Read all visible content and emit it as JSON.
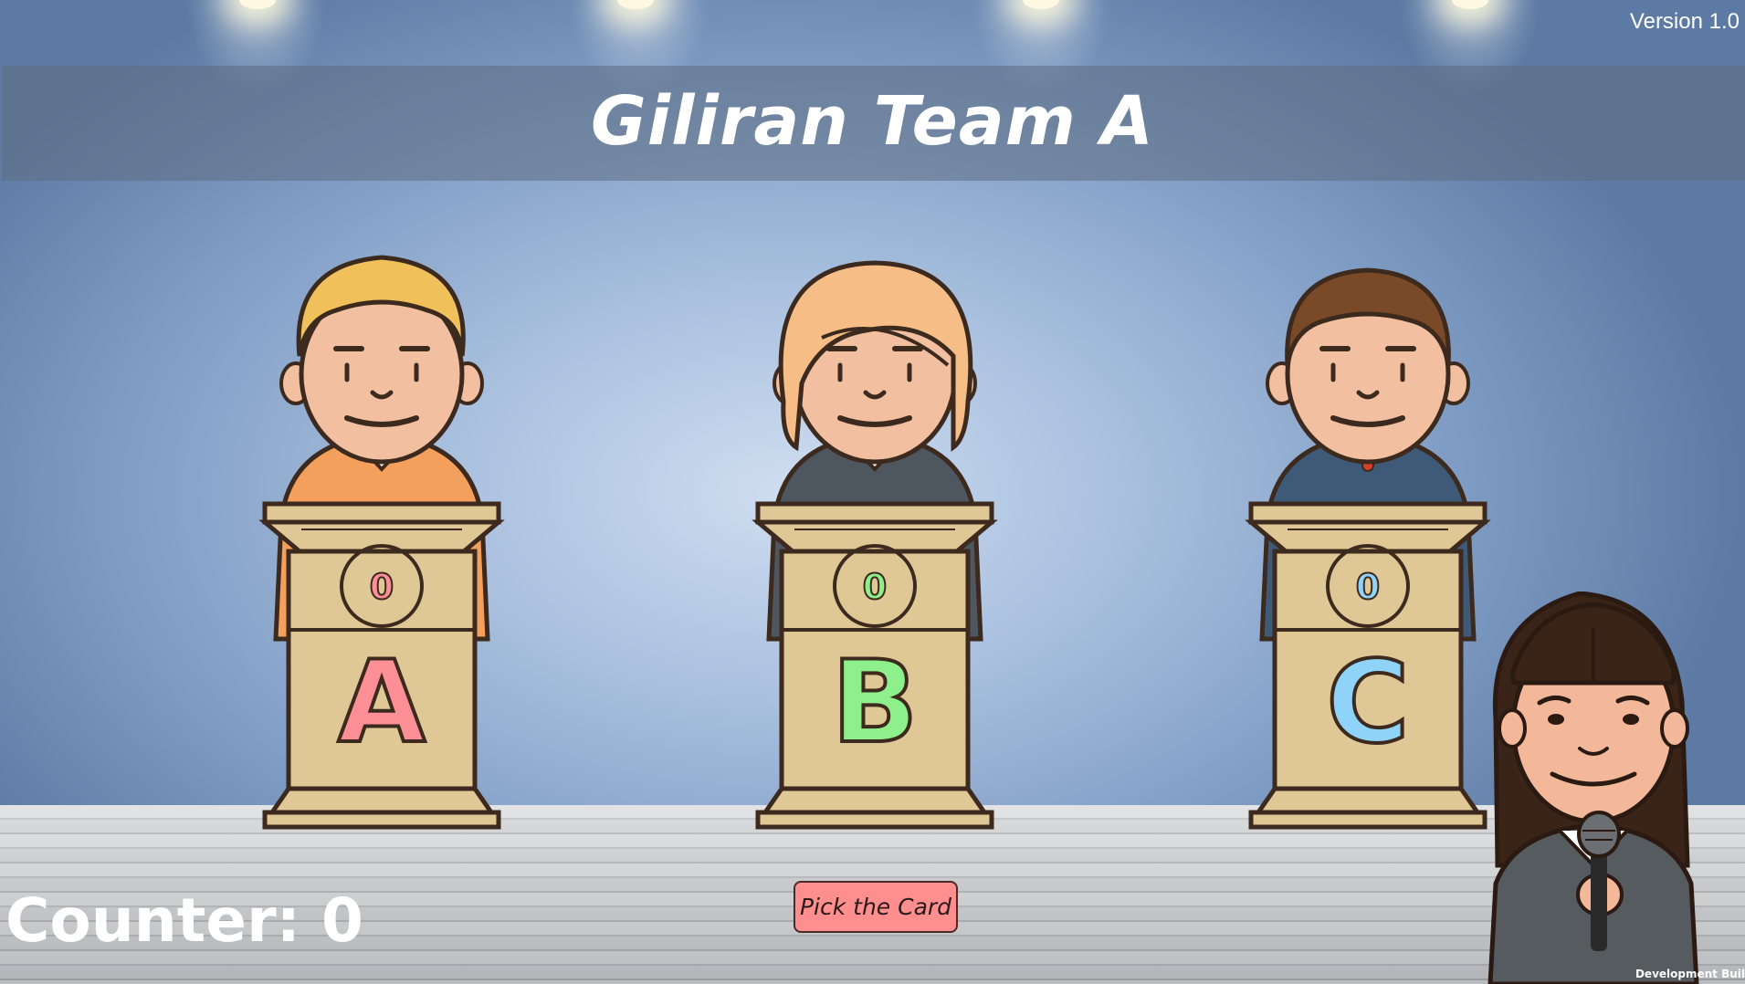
{
  "version_label": "Version 1.0",
  "turn_title": "Giliran Team A",
  "teams": [
    {
      "letter": "A",
      "score": "0",
      "letter_color": "#ff8f96",
      "hair_color": "#f0c15a",
      "shirt_color": "#f4a05c"
    },
    {
      "letter": "B",
      "score": "0",
      "letter_color": "#8ef08a",
      "hair_color": "#f6bd86",
      "shirt_color": "#4e5660"
    },
    {
      "letter": "C",
      "score": "0",
      "letter_color": "#8fd3f8",
      "hair_color": "#7a4a28",
      "shirt_color": "#3f5a78"
    }
  ],
  "counter_label": "Counter: 0",
  "pick_button_label": "Pick the Card",
  "dev_build_label": "Development Buil",
  "colors": {
    "podium": "#e0c796",
    "outline": "#3d2a1e",
    "skin": "#f2c0a0",
    "button": "#ff8f8f"
  }
}
